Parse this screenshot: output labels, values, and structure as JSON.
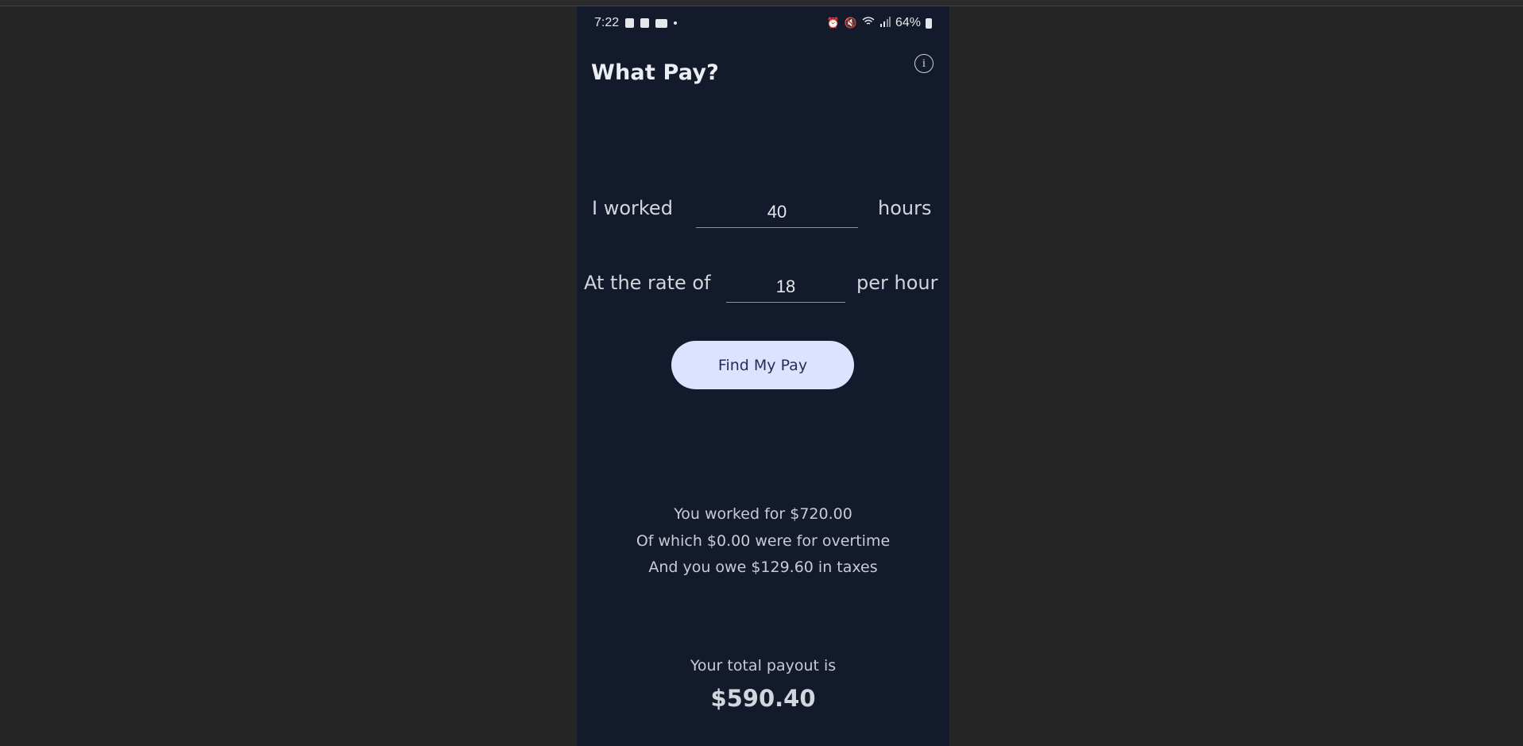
{
  "status_bar": {
    "time": "7:22",
    "battery": "64%",
    "left_icons": [
      "sim-icon",
      "image-icon",
      "voicemail-icon",
      "dot-icon"
    ],
    "right_icons": [
      "alarm-icon",
      "mute-icon",
      "wifi-icon",
      "signal-icon",
      "battery-icon"
    ]
  },
  "app": {
    "title": "What Pay?",
    "info_icon": "info-icon"
  },
  "hours_row": {
    "prefix": "I worked",
    "value": "40",
    "suffix": "hours"
  },
  "rate_row": {
    "prefix": "At the rate of",
    "value": "18",
    "suffix": "per hour"
  },
  "button": {
    "label": "Find My Pay",
    "background": "#dce3ff"
  },
  "summary": {
    "line1": "You worked for $720.00",
    "line2": "Of which $0.00 were for overtime",
    "line3": "And you owe $129.60 in taxes"
  },
  "total": {
    "label": "Your total payout is",
    "value": "$590.40"
  },
  "colors": {
    "screen_background": "#131a2b",
    "desktop_background": "#262626"
  }
}
